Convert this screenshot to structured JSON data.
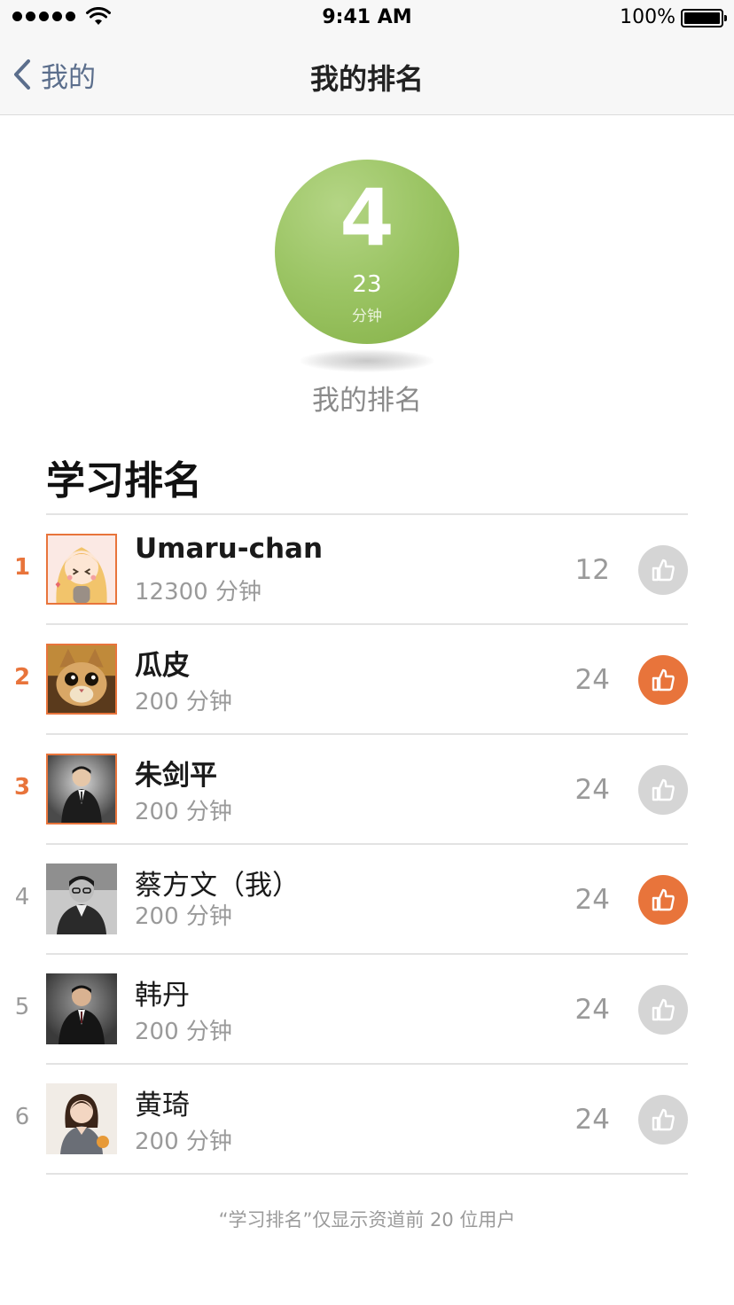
{
  "status_bar": {
    "time": "9:41 AM",
    "battery": "100%",
    "signal_icon": "signal-dots-icon",
    "wifi_icon": "wifi-icon",
    "battery_icon": "battery-icon"
  },
  "nav": {
    "back_label": "我的",
    "title": "我的排名",
    "back_icon": "chevron-left-icon"
  },
  "my_rank": {
    "rank": "4",
    "minutes": "23",
    "unit": "分钟",
    "caption": "我的排名",
    "circle_color": "#9cc565"
  },
  "section_title": "学习排名",
  "colors": {
    "accent": "#e8743b",
    "like_inactive": "#d5d5d5",
    "back_link": "#5b6e8c"
  },
  "rows": [
    {
      "rank": "1",
      "name": "Umaru-chan",
      "minutes": "12300 分钟",
      "likes": "12",
      "liked": false,
      "avatar": "anime-girl-avatar"
    },
    {
      "rank": "2",
      "name": "瓜皮",
      "minutes": "200 分钟",
      "likes": "24",
      "liked": true,
      "avatar": "cat-avatar"
    },
    {
      "rank": "3",
      "name": "朱剑平",
      "minutes": "200 分钟",
      "likes": "24",
      "liked": false,
      "avatar": "man-in-suit-avatar"
    },
    {
      "rank": "4",
      "name": "蔡方文（我）",
      "minutes": "200 分钟",
      "likes": "24",
      "liked": true,
      "avatar": "man-with-glasses-avatar"
    },
    {
      "rank": "5",
      "name": "韩丹",
      "minutes": "200 分钟",
      "likes": "24",
      "liked": false,
      "avatar": "man-in-suit-avatar"
    },
    {
      "rank": "6",
      "name": "黄琦",
      "minutes": "200 分钟",
      "likes": "24",
      "liked": false,
      "avatar": "woman-avatar"
    }
  ],
  "footer_note": "“学习排名”仅显示资道前 20 位用户"
}
